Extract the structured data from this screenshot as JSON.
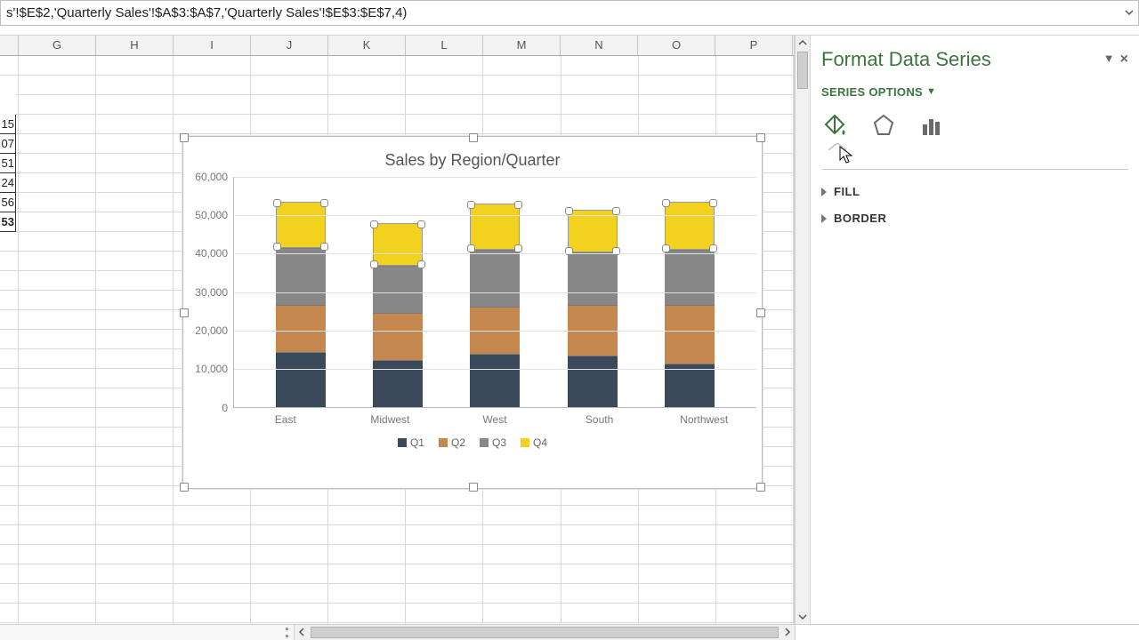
{
  "formula_bar": {
    "text": "s'!$E$2,'Quarterly Sales'!$A$3:$A$7,'Quarterly Sales'!$E$3:$E$7,4)"
  },
  "columns": [
    "G",
    "H",
    "I",
    "J",
    "K",
    "L",
    "M",
    "N",
    "O",
    "P"
  ],
  "partial_cells": [
    "15",
    "07",
    "51",
    "24",
    "56",
    "53"
  ],
  "chart_data": {
    "type": "bar",
    "stacked": true,
    "title": "Sales by Region/Quarter",
    "categories": [
      "East",
      "Midwest",
      "West",
      "South",
      "Northwest"
    ],
    "series": [
      {
        "name": "Q1",
        "color": "#3a4a5a",
        "values": [
          14000,
          12000,
          13500,
          13000,
          11000
        ]
      },
      {
        "name": "Q2",
        "color": "#c4884e",
        "values": [
          12000,
          12000,
          12000,
          13000,
          15000
        ]
      },
      {
        "name": "Q3",
        "color": "#878787",
        "values": [
          14500,
          12000,
          14500,
          13500,
          14000
        ]
      },
      {
        "name": "Q4",
        "color": "#f2d21f",
        "values": [
          12000,
          11000,
          12000,
          11000,
          12500
        ]
      }
    ],
    "yticks": [
      0,
      10000,
      20000,
      30000,
      40000,
      50000,
      60000
    ],
    "ytick_labels": [
      "0",
      "10,000",
      "20,000",
      "30,000",
      "40,000",
      "50,000",
      "60,000"
    ],
    "ylim": [
      0,
      60000
    ],
    "selected_series": "Q4"
  },
  "format_pane": {
    "title": "Format Data Series",
    "series_options_label": "SERIES OPTIONS",
    "tabs": [
      "fill-effects",
      "shape-effects",
      "series-options"
    ],
    "sections": {
      "fill": "FILL",
      "border": "BORDER"
    }
  }
}
